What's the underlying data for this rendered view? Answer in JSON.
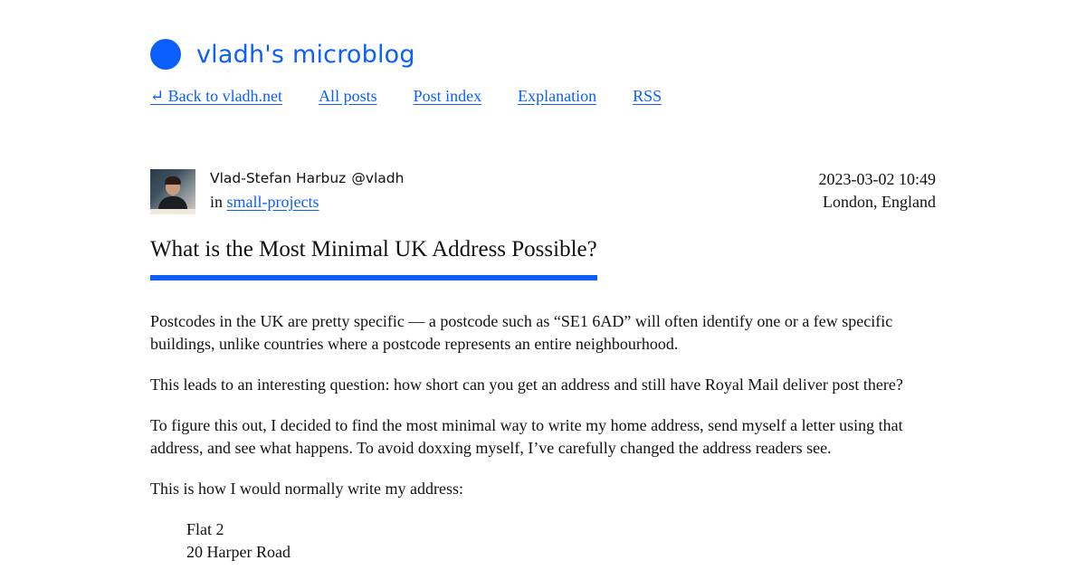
{
  "site": {
    "title": "vladh's microblog",
    "accent_color": "#0b5fff",
    "logo_icon": "circle-dot-icon"
  },
  "nav": {
    "back": "↵ Back to vladh.net",
    "all_posts": "All posts",
    "post_index": "Post index",
    "explanation": "Explanation",
    "rss": "RSS"
  },
  "post": {
    "author_name": "Vlad-Stefan Harbuz",
    "author_handle": "@vladh",
    "category_prefix": "in",
    "category": "small-projects",
    "datetime": "2023-03-02 10:49",
    "location": "London, England",
    "title": "What is the Most Minimal UK Address Possible?",
    "paragraphs": [
      "Postcodes in the UK are pretty specific — a postcode such as “SE1 6AD” will often identify one or a few specific buildings, unlike countries where a postcode represents an entire neighbourhood.",
      "This leads to an interesting question: how short can you get an address and still have Royal Mail deliver post there?",
      "To figure this out, I decided to find the most minimal way to write my home address, send myself a letter using that address, and see what happens. To avoid doxxing myself, I’ve carefully changed the address readers see.",
      "This is how I would normally write my address:"
    ],
    "address_lines": [
      "Flat 2",
      "20 Harper Road"
    ]
  }
}
